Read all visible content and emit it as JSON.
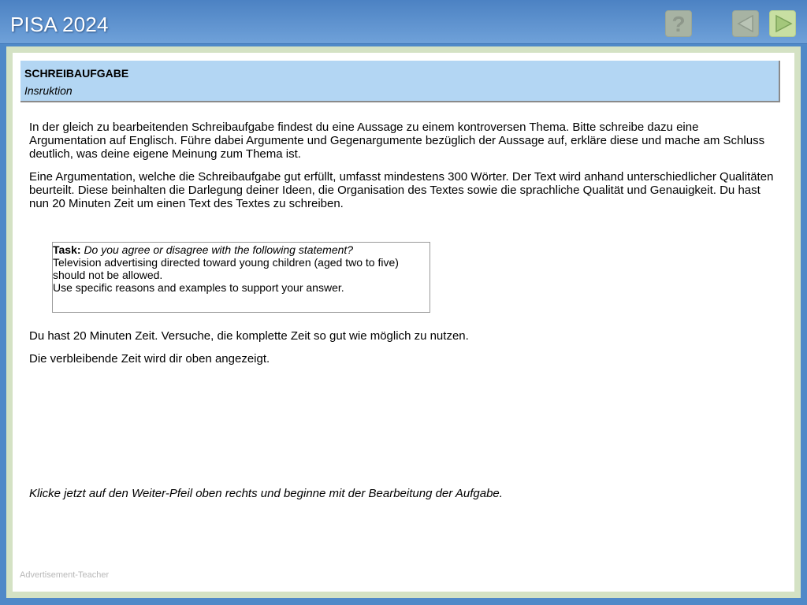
{
  "header": {
    "app_title": "PISA 2024",
    "help_button_icon": "question-mark-icon",
    "back_button_icon": "arrow-left-icon",
    "next_button_icon": "arrow-right-icon"
  },
  "colors": {
    "header_blue": "#4c82c3",
    "frame_green": "#d4e2c4",
    "section_header_bg": "#b3d6f3",
    "next_button_bg": "#c8dfa2",
    "disabled_button_bg": "#a7b3a3"
  },
  "section": {
    "title": "SCHREIBAUFGABE",
    "subtitle": "Insruktion"
  },
  "instructions": {
    "paragraph1": "In der gleich zu bearbeitenden Schreibaufgabe findest du eine Aussage zu einem kontroversen Thema. Bitte schreibe dazu eine Argumentation auf Englisch. Führe dabei Argumente und Gegenargumente bezüglich der Aussage auf, erkläre diese und mache am Schluss deutlich, was deine eigene Meinung zum Thema ist.",
    "paragraph2": "Eine Argumentation, welche die Schreibaufgabe gut erfüllt, umfasst mindestens 300 Wörter. Der Text wird anhand unterschiedlicher Qualitäten beurteilt. Diese beinhalten die Darlegung deiner Ideen, die Organisation des Textes sowie die sprachliche Qualität und Genauigkeit. Du hast nun 20 Minuten Zeit um einen Text des Textes zu schreiben.",
    "paragraph3": "Du hast 20 Minuten Zeit. Versuche, die komplette Zeit so gut wie möglich zu nutzen.",
    "paragraph4": "Die verbleibende Zeit wird dir oben angezeigt.",
    "closing": "Klicke jetzt auf den Weiter-Pfeil oben rechts und beginne mit der Bearbeitung der Aufgabe."
  },
  "task": {
    "label": "Task:",
    "question": "Do you agree or disagree with the following statement?",
    "statement_line1": "Television advertising directed toward young children (aged two to five)",
    "statement_line2": "should not be allowed.",
    "instruction": "Use specific reasons and examples to support your answer."
  },
  "footer": {
    "label": "Advertisement-Teacher"
  }
}
